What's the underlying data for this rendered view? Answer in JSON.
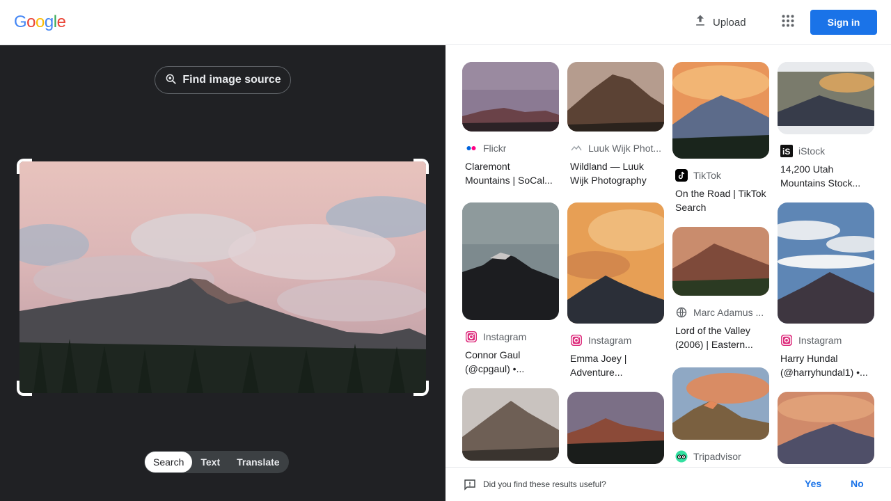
{
  "header": {
    "logo_letters": [
      "G",
      "o",
      "o",
      "g",
      "l",
      "e"
    ],
    "logo_colors": [
      "#4285F4",
      "#EA4335",
      "#FBBC05",
      "#4285F4",
      "#34A853",
      "#EA4335"
    ],
    "upload_label": "Upload",
    "signin_label": "Sign in",
    "accent": "#1a73e8"
  },
  "left": {
    "find_source_label": "Find image source",
    "modes": [
      {
        "label": "Search",
        "active": true
      },
      {
        "label": "Text",
        "active": false
      },
      {
        "label": "Translate",
        "active": false
      }
    ]
  },
  "results": [
    {
      "source": "Flickr",
      "icon": "flickr-icon",
      "title": "Claremont Mountains | SoCal..."
    },
    {
      "source": "Luuk Wijk Phot...",
      "icon": "luuk-wijk-icon",
      "title": "Wildland — Luuk Wijk Photography"
    },
    {
      "source": "TikTok",
      "icon": "tiktok-icon",
      "title": "On the Road | TikTok Search"
    },
    {
      "source": "iStock",
      "icon": "istock-icon",
      "title": "14,200 Utah Mountains Stock..."
    },
    {
      "source": "Instagram",
      "icon": "instagram-icon",
      "title": "Connor Gaul (@cpgaul) •..."
    },
    {
      "source": "Instagram",
      "icon": "instagram-icon",
      "title": "Emma Joey | Adventure..."
    },
    {
      "source": "Marc Adamus ...",
      "icon": "globe-icon",
      "title": "Lord of the Valley (2006) | Eastern..."
    },
    {
      "source": "Instagram",
      "icon": "instagram-icon",
      "title": "Harry Hundal (@harryhundal1) •..."
    },
    {
      "source": "Tripadvisor",
      "icon": "tripadvisor-icon",
      "title": ""
    }
  ],
  "feedback": {
    "question": "Did you find these results useful?",
    "yes": "Yes",
    "no": "No"
  }
}
